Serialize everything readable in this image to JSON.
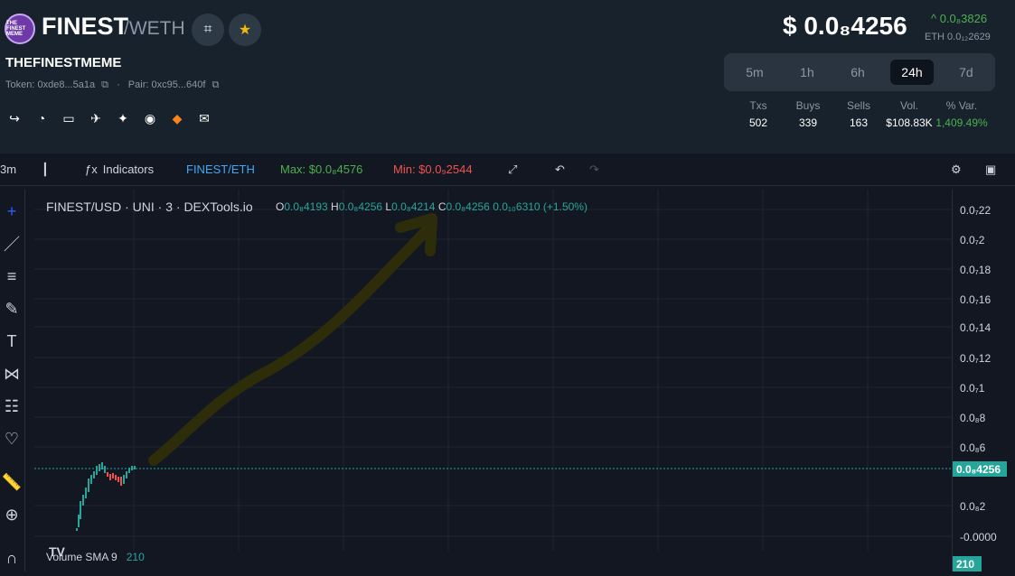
{
  "token": {
    "logo_text": "THE FINEST MEME",
    "symbol": "FINEST",
    "pair": "/WETH",
    "full_name": "THEFINESTMEME",
    "token_addr": "Token: 0xde8...5a1a",
    "pair_addr": "Pair: 0xc95...640f"
  },
  "price": {
    "usd": "$ 0.0₈4256",
    "change": "^ 0.0₈3826",
    "eth": "ETH 0.0₁₂2629"
  },
  "timeframes": [
    "5m",
    "1h",
    "6h",
    "24h",
    "7d"
  ],
  "active_timeframe": "24h",
  "stats": [
    {
      "label": "Txs",
      "value": "502",
      "color": "#ffffff"
    },
    {
      "label": "Buys",
      "value": "339",
      "color": "#ffffff"
    },
    {
      "label": "Sells",
      "value": "163",
      "color": "#ffffff"
    },
    {
      "label": "Vol.",
      "value": "$108.83K",
      "color": "#ffffff"
    },
    {
      "label": "% Var.",
      "value": "1,409.49%",
      "color": "#4caf50"
    }
  ],
  "toolbar": {
    "interval": "3m",
    "indicators": "Indicators",
    "pair": "FINEST/ETH",
    "max": "Max: $0.0₈4576",
    "min": "Min: $0.0₉2544"
  },
  "chart_header": {
    "title": "FINEST/USD · UNI · 3 · DEXTools.io",
    "o_label": "O",
    "o": "0.0₈4193",
    "h_label": "H",
    "h": "0.0₈4256",
    "l_label": "L",
    "l": "0.0₈4214",
    "c_label": "C",
    "c": "0.0₈4256",
    "change": "0.0₁₀6310 (+1.50%)"
  },
  "y_ticks": [
    "0.0₇22",
    "0.0₇2",
    "0.0₇18",
    "0.0₇16",
    "0.0₇14",
    "0.0₇12",
    "0.0₇1",
    "0.0₈8",
    "0.0₈6",
    "0.0₈2",
    "-0.0000"
  ],
  "current_price_label": "0.0₈4256",
  "volume": {
    "label": "Volume SMA 9",
    "value": "210",
    "axis_label": "210"
  },
  "colors": {
    "up": "#26a69a",
    "down": "#ef5350",
    "accent": "#4caf50"
  }
}
